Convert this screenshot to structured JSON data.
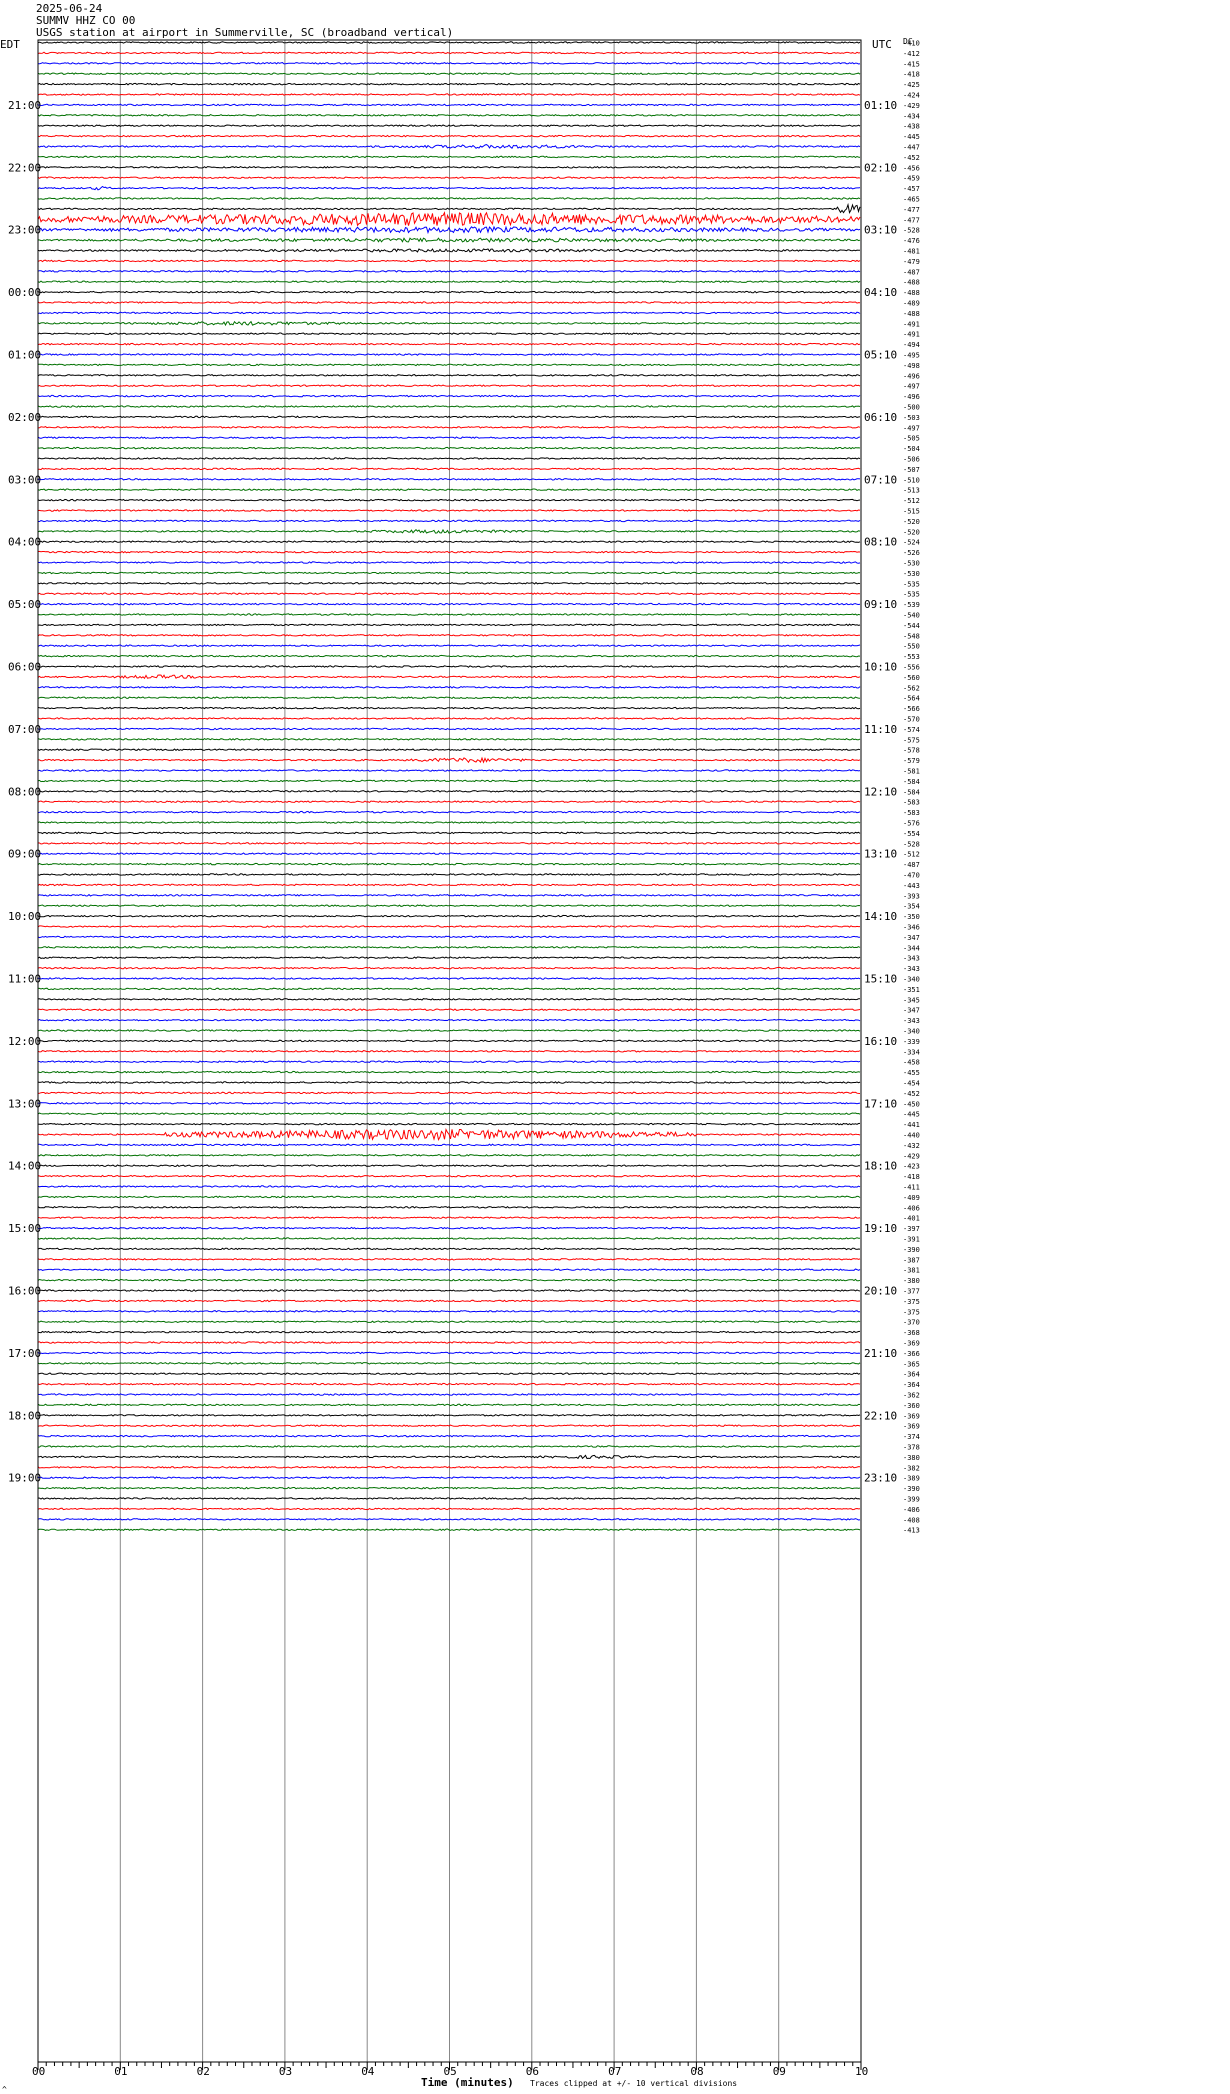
{
  "header": {
    "date": "2025-06-24",
    "station_line": "SUMMV HHZ CO 00",
    "description": "USGS station at airport in Summerville, SC (broadband vertical)"
  },
  "labels": {
    "left_tz": "EDT",
    "right_tz": "UTC",
    "dc_label": "DC",
    "xlabel": "Time (minutes)",
    "clip_note": "Traces clipped at +/- 10 vertical divisions",
    "corner_mark": "^"
  },
  "colors": {
    "trace_cycle": [
      "#000000",
      "#ff0000",
      "#0000ff",
      "#007000"
    ],
    "grid": "#888888",
    "frame": "#000000"
  },
  "chart_data": {
    "type": "line",
    "title": "SUMMV HHZ CO 00",
    "xlabel": "Time (minutes)",
    "xlim": [
      0,
      10
    ],
    "x_ticks": [
      "00",
      "01",
      "02",
      "03",
      "04",
      "05",
      "06",
      "07",
      "08",
      "09",
      "10"
    ],
    "rows_per_hour": 6,
    "row_minutes": 10,
    "start_edt": "20:20",
    "left_hour_labels": [
      "21:00",
      "22:00",
      "23:00",
      "00:00",
      "01:00",
      "02:00",
      "03:00",
      "04:00",
      "05:00",
      "06:00",
      "07:00",
      "08:00",
      "09:00",
      "10:00",
      "11:00",
      "12:00",
      "13:00",
      "14:00",
      "15:00",
      "16:00",
      "17:00",
      "18:00",
      "19:00"
    ],
    "right_hour_labels": [
      "01:10",
      "02:10",
      "03:10",
      "04:10",
      "05:10",
      "06:10",
      "07:10",
      "08:10",
      "09:10",
      "10:10",
      "11:10",
      "12:10",
      "13:10",
      "14:10",
      "15:10",
      "16:10",
      "17:10",
      "18:10",
      "19:10",
      "20:10",
      "21:10",
      "22:10",
      "23:10"
    ],
    "dc_offsets": [
      "-410",
      "-412",
      "-415",
      "-418",
      "-425",
      "-424",
      "-429",
      "-434",
      "-438",
      "-445",
      "-447",
      "-452",
      "-456",
      "-459",
      "-457",
      "-465",
      "-477",
      "-477",
      "-528",
      "-476",
      "-481",
      "-479",
      "-487",
      "-488",
      "-488",
      "-489",
      "-488",
      "-491",
      "-491",
      "-494",
      "-495",
      "-498",
      "-496",
      "-497",
      "-496",
      "-500",
      "-503",
      "-497",
      "-505",
      "-504",
      "-506",
      "-507",
      "-510",
      "-513",
      "-512",
      "-515",
      "-520",
      "-520",
      "-524",
      "-526",
      "-530",
      "-530",
      "-535",
      "-535",
      "-539",
      "-540",
      "-544",
      "-548",
      "-550",
      "-553",
      "-556",
      "-560",
      "-562",
      "-564",
      "-566",
      "-570",
      "-574",
      "-575",
      "-578",
      "-579",
      "-581",
      "-584",
      "-584",
      "-583",
      "-583",
      "-576",
      "-554",
      "-528",
      "-512",
      "-487",
      "-470",
      "-443",
      "-393",
      "-354",
      "-350",
      "-346",
      "-347",
      "-344",
      "-343",
      "-343",
      "-340",
      "-351",
      "-345",
      "-347",
      "-343",
      "-340",
      "-339",
      "-334",
      "-458",
      "-455",
      "-454",
      "-452",
      "-450",
      "-445",
      "-441",
      "-440",
      "-432",
      "-429",
      "-423",
      "-418",
      "-411",
      "-409",
      "-406",
      "-401",
      "-397",
      "-391",
      "-390",
      "-387",
      "-381",
      "-380",
      "-377",
      "-375",
      "-375",
      "-370",
      "-368",
      "-369",
      "-366",
      "-365",
      "-364",
      "-364",
      "-362",
      "-360",
      "-369",
      "-369",
      "-374",
      "-378",
      "-380",
      "-382",
      "-389",
      "-390",
      "-399",
      "-406",
      "-408",
      "-413"
    ],
    "events": [
      {
        "row": 10,
        "start_min": 4.0,
        "end_min": 7.2,
        "amplitude": 2.0
      },
      {
        "row": 14,
        "start_min": 0.6,
        "end_min": 0.9,
        "amplitude": 2.0
      },
      {
        "row": 16,
        "start_min": 9.7,
        "end_min": 10.0,
        "amplitude": 6.0
      },
      {
        "row": 17,
        "start_min": 0.0,
        "end_min": 10.0,
        "amplitude": 7.0
      },
      {
        "row": 18,
        "start_min": 0.0,
        "end_min": 10.0,
        "amplitude": 3.0
      },
      {
        "row": 19,
        "start_min": 0.0,
        "end_min": 10.0,
        "amplitude": 2.0
      },
      {
        "row": 20,
        "start_min": 0.0,
        "end_min": 10.0,
        "amplitude": 1.6
      },
      {
        "row": 27,
        "start_min": 1.0,
        "end_min": 4.0,
        "amplitude": 2.0
      },
      {
        "row": 47,
        "start_min": 3.8,
        "end_min": 6.0,
        "amplitude": 2.0
      },
      {
        "row": 61,
        "start_min": 0.8,
        "end_min": 2.2,
        "amplitude": 2.0
      },
      {
        "row": 69,
        "start_min": 4.5,
        "end_min": 6.0,
        "amplitude": 2.5
      },
      {
        "row": 105,
        "start_min": 1.5,
        "end_min": 8.0,
        "amplitude": 5.5
      },
      {
        "row": 136,
        "start_min": 6.0,
        "end_min": 7.5,
        "amplitude": 1.8
      }
    ]
  }
}
